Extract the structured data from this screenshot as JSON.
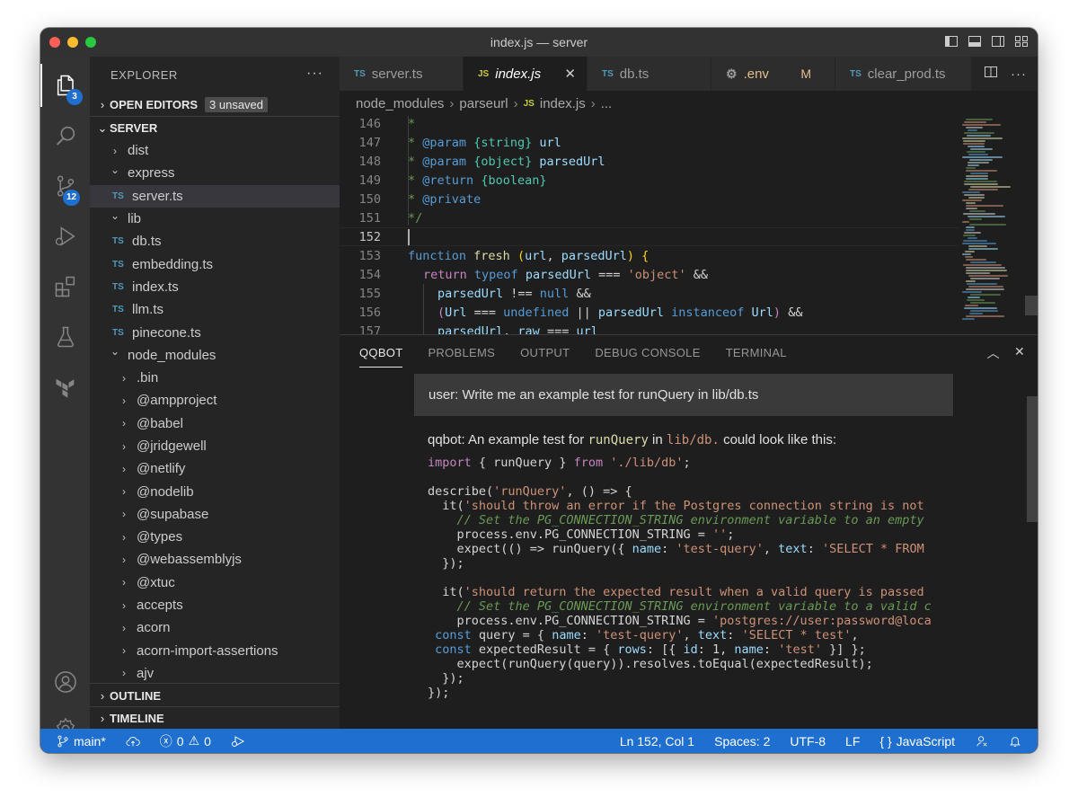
{
  "window": {
    "title": "index.js — server"
  },
  "activity_bar": {
    "explorer_badge": "3",
    "scm_badge": "12"
  },
  "sidebar": {
    "title": "EXPLORER",
    "more": "···",
    "open_editors": {
      "label": "OPEN EDITORS",
      "badge": "3 unsaved"
    },
    "root": "SERVER",
    "tree": [
      {
        "label": "dist",
        "kind": "folder-collapsed"
      },
      {
        "label": "express",
        "kind": "folder-expanded"
      },
      {
        "label": "server.ts",
        "kind": "ts-file",
        "selected": true
      },
      {
        "label": "lib",
        "kind": "folder-expanded"
      },
      {
        "label": "db.ts",
        "kind": "ts-file"
      },
      {
        "label": "embedding.ts",
        "kind": "ts-file"
      },
      {
        "label": "index.ts",
        "kind": "ts-file"
      },
      {
        "label": "llm.ts",
        "kind": "ts-file"
      },
      {
        "label": "pinecone.ts",
        "kind": "ts-file"
      },
      {
        "label": "node_modules",
        "kind": "folder-expanded"
      },
      {
        "label": ".bin",
        "kind": "folder-collapsed"
      },
      {
        "label": "@ampproject",
        "kind": "folder-collapsed"
      },
      {
        "label": "@babel",
        "kind": "folder-collapsed"
      },
      {
        "label": "@jridgewell",
        "kind": "folder-collapsed"
      },
      {
        "label": "@netlify",
        "kind": "folder-collapsed"
      },
      {
        "label": "@nodelib",
        "kind": "folder-collapsed"
      },
      {
        "label": "@supabase",
        "kind": "folder-collapsed"
      },
      {
        "label": "@types",
        "kind": "folder-collapsed"
      },
      {
        "label": "@webassemblyjs",
        "kind": "folder-collapsed"
      },
      {
        "label": "@xtuc",
        "kind": "folder-collapsed"
      },
      {
        "label": "accepts",
        "kind": "folder-collapsed"
      },
      {
        "label": "acorn",
        "kind": "folder-collapsed"
      },
      {
        "label": "acorn-import-assertions",
        "kind": "folder-collapsed"
      },
      {
        "label": "ajv",
        "kind": "folder-collapsed"
      }
    ],
    "outline": "OUTLINE",
    "timeline": "TIMELINE",
    "ts_icon": "TS"
  },
  "tabs": [
    {
      "label": "server.ts",
      "icon": "TS"
    },
    {
      "label": "index.js",
      "icon": "JS",
      "active": true,
      "close": "✕"
    },
    {
      "label": "db.ts",
      "icon": "TS"
    },
    {
      "label": ".env",
      "icon": "gear-icon",
      "modified": "M"
    },
    {
      "label": "clear_prod.ts",
      "icon": "TS"
    }
  ],
  "breadcrumb": {
    "parts": [
      "node_modules",
      "parseurl",
      "index.js",
      "..."
    ],
    "js_icon": "JS",
    "sep": "›"
  },
  "editor": {
    "line_numbers": [
      "146",
      "147",
      "148",
      "149",
      "150",
      "151",
      "152",
      "153",
      "154",
      "155",
      "156",
      "157"
    ],
    "current_line": "152",
    "code": {
      "l146_star": "*",
      "l147_star": "* ",
      "l147_tag": "@param",
      "l147_type": "{string}",
      "l147_name": " url",
      "l148_star": "* ",
      "l148_tag": "@param",
      "l148_type": "{object}",
      "l148_name": " parsedUrl",
      "l149_star": "* ",
      "l149_tag": "@return",
      "l149_type": "{boolean}",
      "l150_star": "* ",
      "l150_tag": "@private",
      "l151": "*/",
      "l153_kw": "function",
      "l153_fn": " fresh",
      "l153_po": " (",
      "l153_a1": "url",
      "l153_c": ", ",
      "l153_a2": "parsedUrl",
      "l153_pc": ")",
      "l153_br": " {",
      "l154_kw": "return",
      "l154_kw2": " typeof",
      "l154_v": " parsedUrl",
      "l154_op": " === ",
      "l154_s": "'object'",
      "l154_and": " &&",
      "l155_v": "parsedUrl",
      "l155_op": " !== ",
      "l155_n": "null",
      "l155_and": " &&",
      "l156_po": "(",
      "l156_v": "Url",
      "l156_op": " === ",
      "l156_u": "undefined",
      "l156_or": " || ",
      "l156_v2": "parsedUrl",
      "l156_io": " instanceof",
      "l156_t": " Url",
      "l156_pc": ")",
      "l156_and": " &&",
      "l157_v": "parsedUrl",
      "l157_dot": ".",
      "l157_p": " raw",
      "l157_op": " === ",
      "l157_u": "url"
    }
  },
  "panel": {
    "tabs": [
      "QQBOT",
      "PROBLEMS",
      "OUTPUT",
      "DEBUG CONSOLE",
      "TERMINAL"
    ],
    "active_tab": "QQBOT",
    "user_message": "user: Write me an example test for runQuery in lib/db.ts",
    "bot_intro": {
      "prefix": "qqbot: An example test for ",
      "fn": "runQuery",
      "mid": " in ",
      "path": "lib/db.",
      "suffix": " could look like this:"
    },
    "snippet": [
      "import { runQuery } from './lib/db';",
      "",
      "describe('runQuery', () => {",
      "  it('should throw an error if the Postgres connection string is not",
      "    // Set the PG_CONNECTION_STRING environment variable to an empty",
      "    process.env.PG_CONNECTION_STRING = '';",
      "    expect(() => runQuery({ name: 'test-query', text: 'SELECT * FROM",
      "  });",
      "",
      "  it('should return the expected result when a valid query is passed",
      "    // Set the PG_CONNECTION_STRING environment variable to a valid c",
      "    process.env.PG_CONNECTION_STRING = 'postgres://user:password@loca",
      " const query = { name: 'test-query', text: 'SELECT * test',",
      " const expectedResult = { rows: [{ id: 1, name: 'test' }] };",
      "    expect(runQuery(query)).resolves.toEqual(expectedResult);",
      "  });",
      "});"
    ]
  },
  "statusbar": {
    "branch": "main*",
    "errors": "0",
    "warnings": "0",
    "position": "Ln 152, Col 1",
    "spaces": "Spaces: 2",
    "encoding": "UTF-8",
    "eol": "LF",
    "language_braces": "{ }",
    "language": "JavaScript"
  }
}
